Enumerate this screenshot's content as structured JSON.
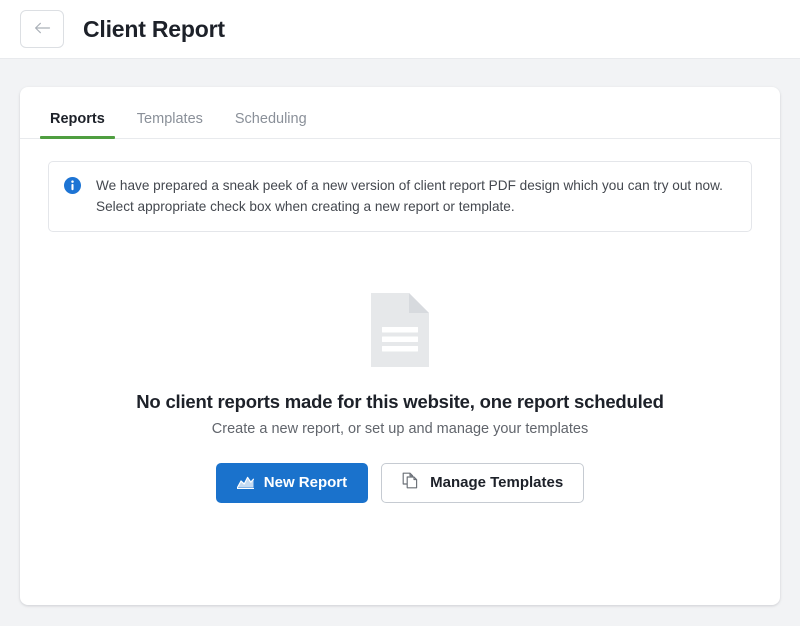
{
  "header": {
    "back_icon": "arrow-left-icon",
    "title": "Client Report"
  },
  "tabs": [
    {
      "label": "Reports",
      "active": true
    },
    {
      "label": "Templates",
      "active": false
    },
    {
      "label": "Scheduling",
      "active": false
    }
  ],
  "banner": {
    "icon": "info-circle-icon",
    "text": "We have prepared a sneak peek of a new version of client report PDF design which you can try out now. Select appropriate check box when creating a new report or template."
  },
  "empty_state": {
    "icon": "document-lines-icon",
    "title": "No client reports made for this website, one report scheduled",
    "subtitle": "Create a new report, or set up and manage your templates",
    "primary_button": {
      "label": "New Report",
      "icon": "chart-area-icon"
    },
    "secondary_button": {
      "label": "Manage Templates",
      "icon": "copy-pages-icon"
    }
  },
  "colors": {
    "page_background": "#f2f3f5",
    "card_background": "#ffffff",
    "accent_green": "#4f9e40",
    "primary_blue": "#1a72cc",
    "info_blue": "#1d74d4",
    "text_primary": "#1d2129",
    "text_muted": "#8a9099",
    "border": "#e8eaed",
    "doc_icon_gray": "#e6e8ea"
  }
}
